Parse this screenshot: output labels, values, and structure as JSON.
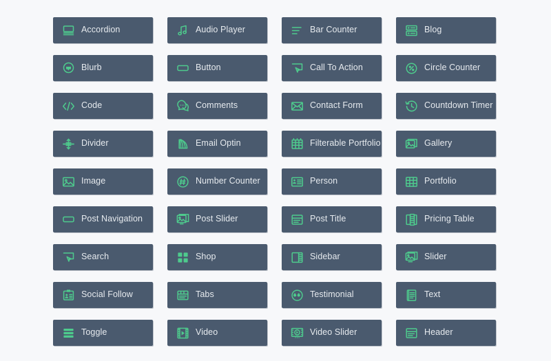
{
  "grid": {
    "columns": 4,
    "card_bg": "#4a5a6e",
    "icon_color": "#4ecb8d",
    "label_color": "#e6eaee",
    "page_bg": "#f7f8fa",
    "modules": [
      {
        "label": "Accordion",
        "icon": "accordion-icon"
      },
      {
        "label": "Audio Player",
        "icon": "music-note-icon"
      },
      {
        "label": "Bar Counter",
        "icon": "bar-counter-icon"
      },
      {
        "label": "Blog",
        "icon": "blog-icon"
      },
      {
        "label": "Blurb",
        "icon": "blurb-speech-bubble-icon"
      },
      {
        "label": "Button",
        "icon": "button-icon"
      },
      {
        "label": "Call To Action",
        "icon": "call-to-action-cursor-icon"
      },
      {
        "label": "Circle Counter",
        "icon": "circle-counter-icon"
      },
      {
        "label": "Code",
        "icon": "code-brackets-icon"
      },
      {
        "label": "Comments",
        "icon": "comments-bubble-icon"
      },
      {
        "label": "Contact Form",
        "icon": "envelope-icon"
      },
      {
        "label": "Countdown Timer",
        "icon": "countdown-clock-icon"
      },
      {
        "label": "Divider",
        "icon": "divider-arrows-icon"
      },
      {
        "label": "Email Optin",
        "icon": "email-optin-signal-icon"
      },
      {
        "label": "Filterable Portfolio",
        "icon": "filterable-grid-icon"
      },
      {
        "label": "Gallery",
        "icon": "gallery-stack-icon"
      },
      {
        "label": "Image",
        "icon": "image-icon"
      },
      {
        "label": "Number Counter",
        "icon": "number-counter-hash-icon"
      },
      {
        "label": "Person",
        "icon": "person-card-icon"
      },
      {
        "label": "Portfolio",
        "icon": "portfolio-grid-icon"
      },
      {
        "label": "Post Navigation",
        "icon": "post-navigation-icon"
      },
      {
        "label": "Post Slider",
        "icon": "post-slider-icon"
      },
      {
        "label": "Post Title",
        "icon": "post-title-icon"
      },
      {
        "label": "Pricing Table",
        "icon": "pricing-table-icon"
      },
      {
        "label": "Search",
        "icon": "search-cursor-icon"
      },
      {
        "label": "Shop",
        "icon": "shop-squares-icon"
      },
      {
        "label": "Sidebar",
        "icon": "sidebar-icon"
      },
      {
        "label": "Slider",
        "icon": "slider-icon"
      },
      {
        "label": "Social Follow",
        "icon": "social-follow-icon"
      },
      {
        "label": "Tabs",
        "icon": "tabs-icon"
      },
      {
        "label": "Testimonial",
        "icon": "testimonial-quote-icon"
      },
      {
        "label": "Text",
        "icon": "text-document-icon"
      },
      {
        "label": "Toggle",
        "icon": "toggle-stack-icon"
      },
      {
        "label": "Video",
        "icon": "video-film-icon"
      },
      {
        "label": "Video Slider",
        "icon": "video-slider-icon"
      },
      {
        "label": "Header",
        "icon": "header-icon"
      }
    ]
  }
}
